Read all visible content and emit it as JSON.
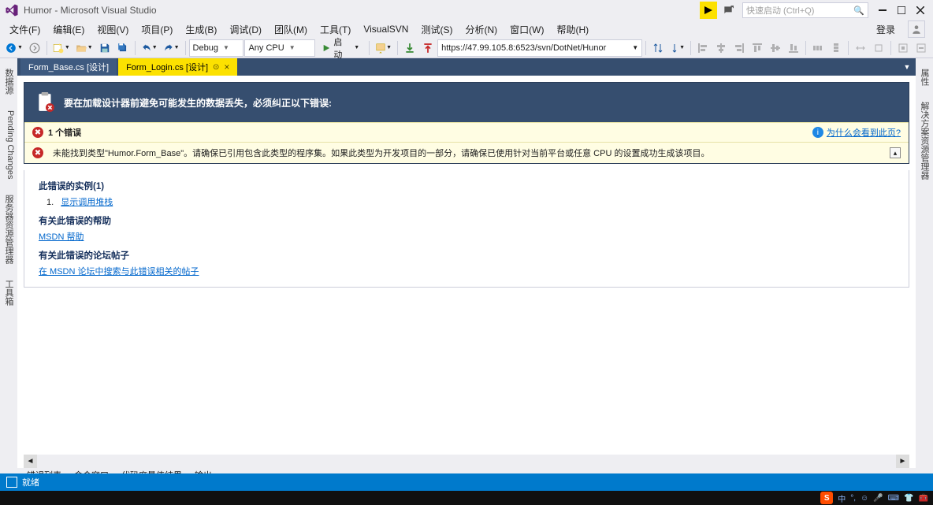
{
  "title": "Humor - Microsoft Visual Studio",
  "quick_launch_placeholder": "快速启动 (Ctrl+Q)",
  "login_text": "登录",
  "menus": [
    "文件(F)",
    "编辑(E)",
    "视图(V)",
    "项目(P)",
    "生成(B)",
    "调试(D)",
    "团队(M)",
    "工具(T)",
    "VisualSVN",
    "测试(S)",
    "分析(N)",
    "窗口(W)",
    "帮助(H)"
  ],
  "toolbar": {
    "config": "Debug",
    "platform": "Any CPU",
    "start": "启动",
    "svn_url": "https://47.99.105.8:6523/svn/DotNet/Hunor"
  },
  "doc_tabs": {
    "inactive": "Form_Base.cs [设计]",
    "active": "Form_Login.cs [设计]"
  },
  "side_left": [
    "数据源",
    "Pending Changes",
    "服务器资源管理器",
    "工具箱"
  ],
  "side_right": [
    "属性",
    "解决方案资源管理器"
  ],
  "banner": {
    "title": "要在加载设计器前避免可能发生的数据丢失，必须纠正以下错误:",
    "count_label": "1 个错误",
    "why_link": "为什么会看到此页?",
    "message": "未能找到类型\"Humor.Form_Base\"。请确保已引用包含此类型的程序集。如果此类型为开发项目的一部分，请确保已使用针对当前平台或任意 CPU 的设置成功生成该项目。"
  },
  "detail": {
    "instances_heading": "此错误的实例(1)",
    "instance_num": "1.",
    "show_stack": "显示调用堆栈",
    "help_heading": "有关此错误的帮助",
    "msdn_help": "MSDN 帮助",
    "forum_heading": "有关此错误的论坛帖子",
    "forum_search": "在 MSDN 论坛中搜索与此错误相关的帖子"
  },
  "bottom_tabs": [
    "错误列表",
    "命令窗口",
    "代码度量值结果",
    "输出"
  ],
  "status": "就绪",
  "ime": "中"
}
